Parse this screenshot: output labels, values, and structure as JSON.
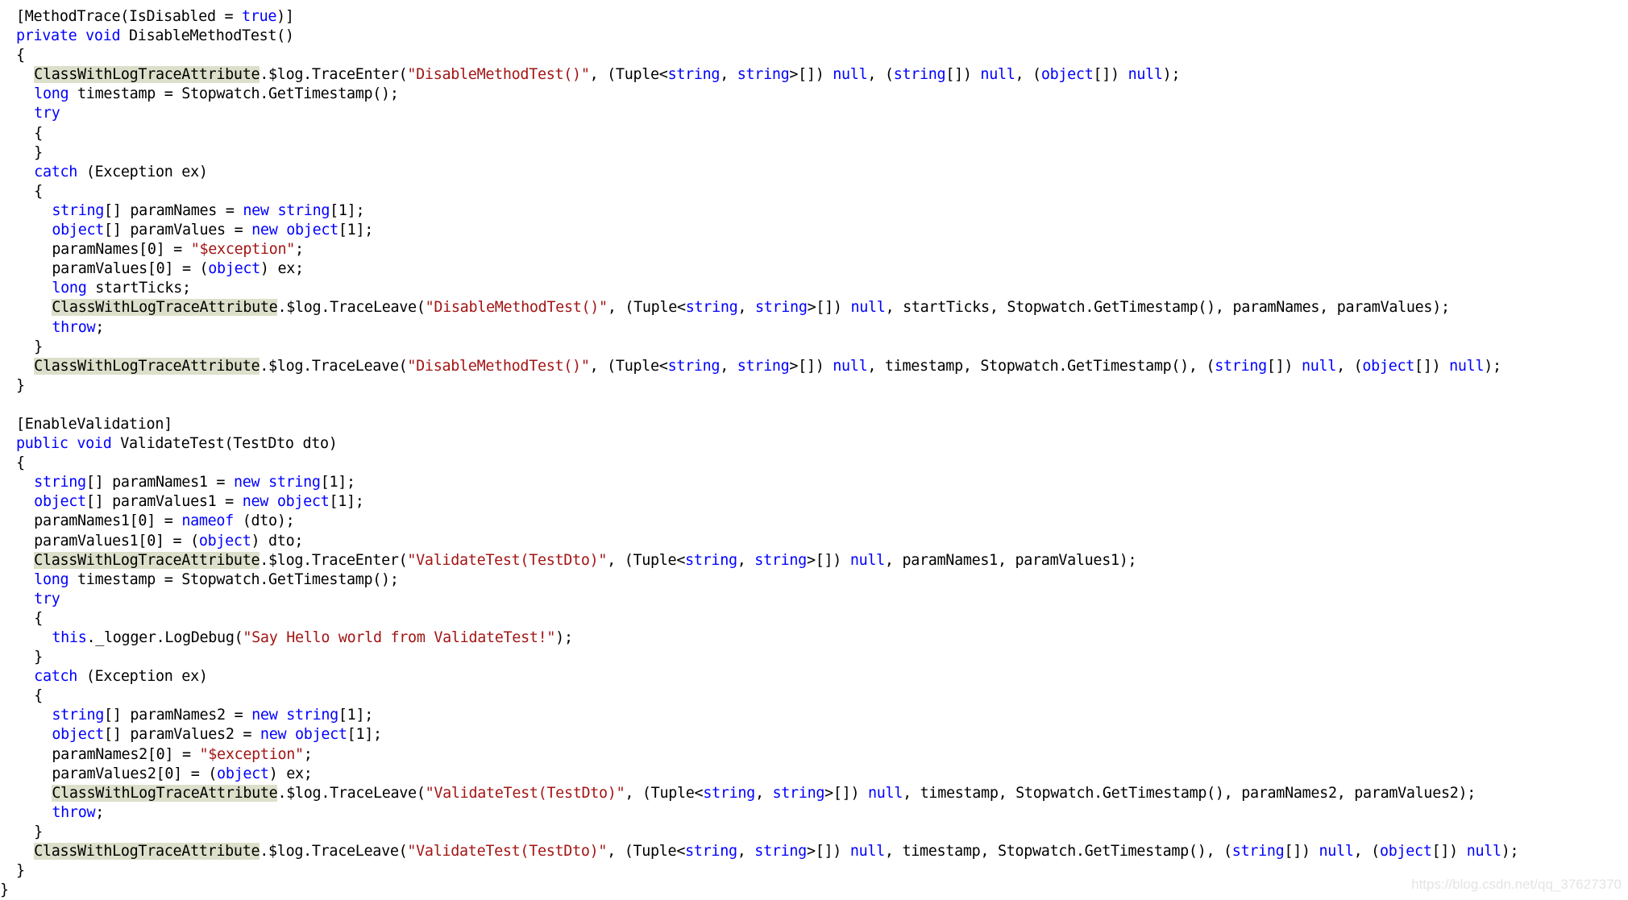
{
  "colors": {
    "keyword": "#0000ff",
    "string": "#a31515",
    "text": "#000000",
    "highlight": "#dcdfca",
    "background": "#ffffff"
  },
  "watermark": "https://blog.csdn.net/qq_37627370",
  "lines": [
    {
      "indent": 0.9,
      "tokens": [
        [
          "t",
          "[MethodTrace(IsDisabled = "
        ],
        [
          "k",
          "true"
        ],
        [
          "t",
          ")]"
        ]
      ]
    },
    {
      "indent": 0.9,
      "tokens": [
        [
          "k",
          "private"
        ],
        [
          "t",
          " "
        ],
        [
          "k",
          "void"
        ],
        [
          "t",
          " DisableMethodTest()"
        ]
      ]
    },
    {
      "indent": 0.9,
      "tokens": [
        [
          "t",
          "{"
        ]
      ]
    },
    {
      "indent": 1.9,
      "tokens": [
        [
          "h",
          "ClassWithLogTraceAttribute"
        ],
        [
          "t",
          "."
        ],
        [
          "t",
          "$log.TraceEnter("
        ],
        [
          "s",
          "\"DisableMethodTest()\""
        ],
        [
          "t",
          ", (Tuple<"
        ],
        [
          "k",
          "string"
        ],
        [
          "t",
          ", "
        ],
        [
          "k",
          "string"
        ],
        [
          "t",
          ">[]) "
        ],
        [
          "k",
          "null"
        ],
        [
          "t",
          ", ("
        ],
        [
          "k",
          "string"
        ],
        [
          "t",
          "[]) "
        ],
        [
          "k",
          "null"
        ],
        [
          "t",
          ", ("
        ],
        [
          "k",
          "object"
        ],
        [
          "t",
          "[]) "
        ],
        [
          "k",
          "null"
        ],
        [
          "t",
          ");"
        ]
      ]
    },
    {
      "indent": 1.9,
      "tokens": [
        [
          "k",
          "long"
        ],
        [
          "t",
          " timestamp = Stopwatch.GetTimestamp();"
        ]
      ]
    },
    {
      "indent": 1.9,
      "tokens": [
        [
          "k",
          "try"
        ]
      ]
    },
    {
      "indent": 1.9,
      "tokens": [
        [
          "t",
          "{"
        ]
      ]
    },
    {
      "indent": 1.9,
      "tokens": [
        [
          "t",
          "}"
        ]
      ]
    },
    {
      "indent": 1.9,
      "tokens": [
        [
          "k",
          "catch"
        ],
        [
          "t",
          " (Exception ex)"
        ]
      ]
    },
    {
      "indent": 1.9,
      "tokens": [
        [
          "t",
          "{"
        ]
      ]
    },
    {
      "indent": 2.9,
      "tokens": [
        [
          "k",
          "string"
        ],
        [
          "t",
          "[] paramNames = "
        ],
        [
          "k",
          "new"
        ],
        [
          "t",
          " "
        ],
        [
          "k",
          "string"
        ],
        [
          "t",
          "[1];"
        ]
      ]
    },
    {
      "indent": 2.9,
      "tokens": [
        [
          "k",
          "object"
        ],
        [
          "t",
          "[] paramValues = "
        ],
        [
          "k",
          "new"
        ],
        [
          "t",
          " "
        ],
        [
          "k",
          "object"
        ],
        [
          "t",
          "[1];"
        ]
      ]
    },
    {
      "indent": 2.9,
      "tokens": [
        [
          "t",
          "paramNames[0] = "
        ],
        [
          "s",
          "\"$exception\""
        ],
        [
          "t",
          ";"
        ]
      ]
    },
    {
      "indent": 2.9,
      "tokens": [
        [
          "t",
          "paramValues[0] = ("
        ],
        [
          "k",
          "object"
        ],
        [
          "t",
          ") ex;"
        ]
      ]
    },
    {
      "indent": 2.9,
      "tokens": [
        [
          "k",
          "long"
        ],
        [
          "t",
          " startTicks;"
        ]
      ]
    },
    {
      "indent": 2.9,
      "tokens": [
        [
          "h",
          "ClassWithLogTraceAttribute"
        ],
        [
          "t",
          "."
        ],
        [
          "t",
          "$log.TraceLeave("
        ],
        [
          "s",
          "\"DisableMethodTest()\""
        ],
        [
          "t",
          ", (Tuple<"
        ],
        [
          "k",
          "string"
        ],
        [
          "t",
          ", "
        ],
        [
          "k",
          "string"
        ],
        [
          "t",
          ">[]) "
        ],
        [
          "k",
          "null"
        ],
        [
          "t",
          ", startTicks, Stopwatch.GetTimestamp(), paramNames, paramValues);"
        ]
      ]
    },
    {
      "indent": 2.9,
      "tokens": [
        [
          "k",
          "throw"
        ],
        [
          "t",
          ";"
        ]
      ]
    },
    {
      "indent": 1.9,
      "tokens": [
        [
          "t",
          "}"
        ]
      ]
    },
    {
      "indent": 1.9,
      "tokens": [
        [
          "h",
          "ClassWithLogTraceAttribute"
        ],
        [
          "t",
          "."
        ],
        [
          "t",
          "$log.TraceLeave("
        ],
        [
          "s",
          "\"DisableMethodTest()\""
        ],
        [
          "t",
          ", (Tuple<"
        ],
        [
          "k",
          "string"
        ],
        [
          "t",
          ", "
        ],
        [
          "k",
          "string"
        ],
        [
          "t",
          ">[]) "
        ],
        [
          "k",
          "null"
        ],
        [
          "t",
          ", timestamp, Stopwatch.GetTimestamp(), ("
        ],
        [
          "k",
          "string"
        ],
        [
          "t",
          "[]) "
        ],
        [
          "k",
          "null"
        ],
        [
          "t",
          ", ("
        ],
        [
          "k",
          "object"
        ],
        [
          "t",
          "[]) "
        ],
        [
          "k",
          "null"
        ],
        [
          "t",
          ");"
        ]
      ]
    },
    {
      "indent": 0.9,
      "tokens": [
        [
          "t",
          "}"
        ]
      ]
    },
    {
      "indent": 0.9,
      "tokens": []
    },
    {
      "indent": 0.9,
      "tokens": [
        [
          "t",
          "[EnableValidation]"
        ]
      ]
    },
    {
      "indent": 0.9,
      "tokens": [
        [
          "k",
          "public"
        ],
        [
          "t",
          " "
        ],
        [
          "k",
          "void"
        ],
        [
          "t",
          " ValidateTest(TestDto dto)"
        ]
      ]
    },
    {
      "indent": 0.9,
      "tokens": [
        [
          "t",
          "{"
        ]
      ]
    },
    {
      "indent": 1.9,
      "tokens": [
        [
          "k",
          "string"
        ],
        [
          "t",
          "[] paramNames1 = "
        ],
        [
          "k",
          "new"
        ],
        [
          "t",
          " "
        ],
        [
          "k",
          "string"
        ],
        [
          "t",
          "[1];"
        ]
      ]
    },
    {
      "indent": 1.9,
      "tokens": [
        [
          "k",
          "object"
        ],
        [
          "t",
          "[] paramValues1 = "
        ],
        [
          "k",
          "new"
        ],
        [
          "t",
          " "
        ],
        [
          "k",
          "object"
        ],
        [
          "t",
          "[1];"
        ]
      ]
    },
    {
      "indent": 1.9,
      "tokens": [
        [
          "t",
          "paramNames1[0] = "
        ],
        [
          "k",
          "nameof"
        ],
        [
          "t",
          " (dto);"
        ]
      ]
    },
    {
      "indent": 1.9,
      "tokens": [
        [
          "t",
          "paramValues1[0] = ("
        ],
        [
          "k",
          "object"
        ],
        [
          "t",
          ") dto;"
        ]
      ]
    },
    {
      "indent": 1.9,
      "tokens": [
        [
          "h",
          "ClassWithLogTraceAttribute"
        ],
        [
          "t",
          "."
        ],
        [
          "t",
          "$log.TraceEnter("
        ],
        [
          "s",
          "\"ValidateTest(TestDto)\""
        ],
        [
          "t",
          ", (Tuple<"
        ],
        [
          "k",
          "string"
        ],
        [
          "t",
          ", "
        ],
        [
          "k",
          "string"
        ],
        [
          "t",
          ">[]) "
        ],
        [
          "k",
          "null"
        ],
        [
          "t",
          ", paramNames1, paramValues1);"
        ]
      ]
    },
    {
      "indent": 1.9,
      "tokens": [
        [
          "k",
          "long"
        ],
        [
          "t",
          " timestamp = Stopwatch.GetTimestamp();"
        ]
      ]
    },
    {
      "indent": 1.9,
      "tokens": [
        [
          "k",
          "try"
        ]
      ]
    },
    {
      "indent": 1.9,
      "tokens": [
        [
          "t",
          "{"
        ]
      ]
    },
    {
      "indent": 2.9,
      "tokens": [
        [
          "k",
          "this"
        ],
        [
          "t",
          "._logger.LogDebug("
        ],
        [
          "s",
          "\"Say Hello world from ValidateTest!\""
        ],
        [
          "t",
          ");"
        ]
      ]
    },
    {
      "indent": 1.9,
      "tokens": [
        [
          "t",
          "}"
        ]
      ]
    },
    {
      "indent": 1.9,
      "tokens": [
        [
          "k",
          "catch"
        ],
        [
          "t",
          " (Exception ex)"
        ]
      ]
    },
    {
      "indent": 1.9,
      "tokens": [
        [
          "t",
          "{"
        ]
      ]
    },
    {
      "indent": 2.9,
      "tokens": [
        [
          "k",
          "string"
        ],
        [
          "t",
          "[] paramNames2 = "
        ],
        [
          "k",
          "new"
        ],
        [
          "t",
          " "
        ],
        [
          "k",
          "string"
        ],
        [
          "t",
          "[1];"
        ]
      ]
    },
    {
      "indent": 2.9,
      "tokens": [
        [
          "k",
          "object"
        ],
        [
          "t",
          "[] paramValues2 = "
        ],
        [
          "k",
          "new"
        ],
        [
          "t",
          " "
        ],
        [
          "k",
          "object"
        ],
        [
          "t",
          "[1];"
        ]
      ]
    },
    {
      "indent": 2.9,
      "tokens": [
        [
          "t",
          "paramNames2[0] = "
        ],
        [
          "s",
          "\"$exception\""
        ],
        [
          "t",
          ";"
        ]
      ]
    },
    {
      "indent": 2.9,
      "tokens": [
        [
          "t",
          "paramValues2[0] = ("
        ],
        [
          "k",
          "object"
        ],
        [
          "t",
          ") ex;"
        ]
      ]
    },
    {
      "indent": 2.9,
      "tokens": [
        [
          "h",
          "ClassWithLogTraceAttribute"
        ],
        [
          "t",
          "."
        ],
        [
          "t",
          "$log.TraceLeave("
        ],
        [
          "s",
          "\"ValidateTest(TestDto)\""
        ],
        [
          "t",
          ", (Tuple<"
        ],
        [
          "k",
          "string"
        ],
        [
          "t",
          ", "
        ],
        [
          "k",
          "string"
        ],
        [
          "t",
          ">[]) "
        ],
        [
          "k",
          "null"
        ],
        [
          "t",
          ", timestamp, Stopwatch.GetTimestamp(), paramNames2, paramValues2);"
        ]
      ]
    },
    {
      "indent": 2.9,
      "tokens": [
        [
          "k",
          "throw"
        ],
        [
          "t",
          ";"
        ]
      ]
    },
    {
      "indent": 1.9,
      "tokens": [
        [
          "t",
          "}"
        ]
      ]
    },
    {
      "indent": 1.9,
      "tokens": [
        [
          "h",
          "ClassWithLogTraceAttribute"
        ],
        [
          "t",
          "."
        ],
        [
          "t",
          "$log.TraceLeave("
        ],
        [
          "s",
          "\"ValidateTest(TestDto)\""
        ],
        [
          "t",
          ", (Tuple<"
        ],
        [
          "k",
          "string"
        ],
        [
          "t",
          ", "
        ],
        [
          "k",
          "string"
        ],
        [
          "t",
          ">[]) "
        ],
        [
          "k",
          "null"
        ],
        [
          "t",
          ", timestamp, Stopwatch.GetTimestamp(), ("
        ],
        [
          "k",
          "string"
        ],
        [
          "t",
          "[]) "
        ],
        [
          "k",
          "null"
        ],
        [
          "t",
          ", ("
        ],
        [
          "k",
          "object"
        ],
        [
          "t",
          "[]) "
        ],
        [
          "k",
          "null"
        ],
        [
          "t",
          ");"
        ]
      ]
    },
    {
      "indent": 0.9,
      "tokens": [
        [
          "t",
          "}"
        ]
      ]
    },
    {
      "indent": 0,
      "tokens": [
        [
          "t",
          "}"
        ]
      ]
    }
  ]
}
